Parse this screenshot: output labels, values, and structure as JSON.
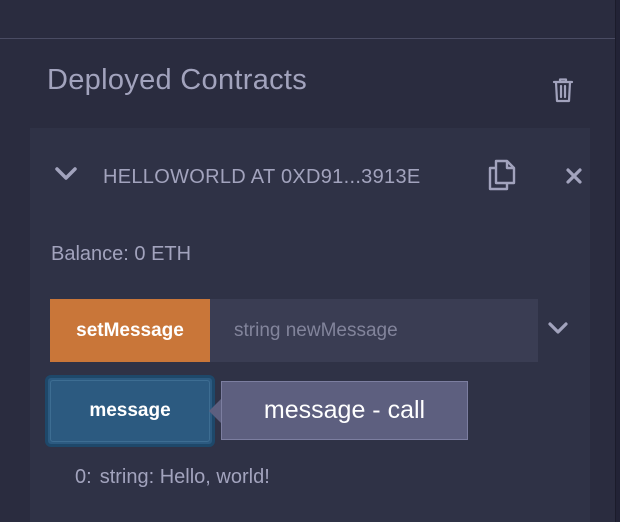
{
  "panel": {
    "title": "Deployed Contracts"
  },
  "contract": {
    "name": "HELLOWORLD AT 0XD91...3913E",
    "balance": "Balance: 0 ETH"
  },
  "functions": {
    "set_message": {
      "label": "setMessage",
      "placeholder": "string newMessage"
    },
    "message": {
      "label": "message",
      "tooltip": "message - call"
    }
  },
  "result": {
    "index": "0:",
    "value": "string: Hello, world!"
  },
  "icons": {
    "trash": "trash-icon",
    "collapse": "chevron-down-icon",
    "copy": "copy-icon",
    "close": "close-icon",
    "expand": "chevron-down-icon"
  },
  "colors": {
    "background": "#2a2c3f",
    "card": "#2f3246",
    "text": "#a2a3bd",
    "transact_button": "#c97639",
    "call_button": "#2c5a80",
    "tooltip": "#5d5f7f"
  }
}
